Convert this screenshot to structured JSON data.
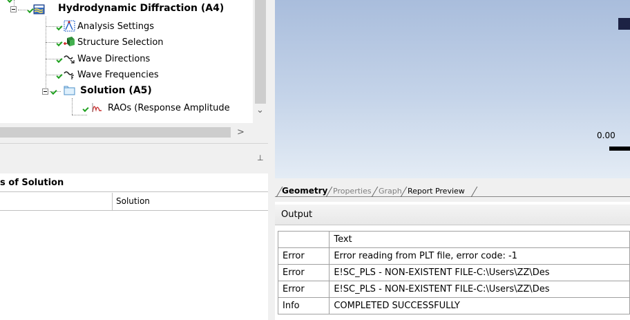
{
  "tree": {
    "nodes": [
      {
        "label": "Hydrodynamic Diffraction (A4)",
        "bold": true,
        "icon": "hydrodynamic-diffraction-icon"
      },
      {
        "label": "Analysis Settings",
        "icon": "analysis-settings-icon"
      },
      {
        "label": "Structure Selection",
        "icon": "structure-selection-icon"
      },
      {
        "label": "Wave Directions",
        "icon": "wave-directions-icon"
      },
      {
        "label": "Wave Frequencies",
        "icon": "wave-frequencies-icon"
      },
      {
        "label": "Solution (A5)",
        "bold": true,
        "icon": "solution-folder-icon"
      },
      {
        "label": "RAOs (Response Amplitude",
        "icon": "rao-icon"
      }
    ],
    "scroll_right_glyph": ">",
    "scroll_down_glyph": "⌄"
  },
  "details": {
    "pin_glyph": "⊥",
    "group_title": "s of Solution",
    "row_value": "Solution"
  },
  "viewport": {
    "scale_value": "0.00",
    "background_top": "#a9bddc",
    "background_bottom": "#e4ecf5"
  },
  "tabs": [
    {
      "label": "Geometry",
      "state": "active"
    },
    {
      "label": "Properties",
      "state": "inactive"
    },
    {
      "label": "Graph",
      "state": "inactive"
    },
    {
      "label": "Report Preview",
      "state": "plain"
    }
  ],
  "output": {
    "title": "Output",
    "header": [
      "",
      "Text"
    ],
    "rows": [
      {
        "type": "Error",
        "text": " Error reading from PLT file, error code: -1"
      },
      {
        "type": "Error",
        "text": "E!SC_PLS - NON-EXISTENT FILE-C:\\Users\\ZZ\\Des"
      },
      {
        "type": "Error",
        "text": "E!SC_PLS - NON-EXISTENT FILE-C:\\Users\\ZZ\\Des"
      },
      {
        "type": "Info",
        "text": " COMPLETED SUCCESSFULLY"
      }
    ]
  },
  "colors": {
    "ok_check": "#21a121",
    "accent_block": "#1c2244"
  }
}
